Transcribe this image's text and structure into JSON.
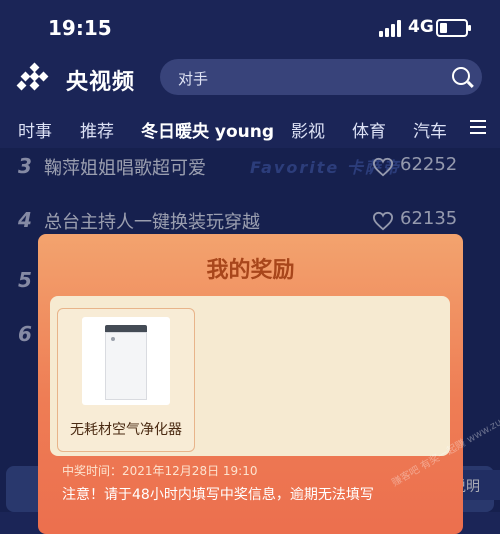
{
  "status_bar": {
    "time": "19:15",
    "network": "4G",
    "battery_level": 0.3
  },
  "header": {
    "app_name": "央视频",
    "search_placeholder": "对手"
  },
  "tabs": [
    {
      "label": "时事"
    },
    {
      "label": "推荐"
    },
    {
      "label": "冬日暖央 young",
      "active": true
    },
    {
      "label": "影视"
    },
    {
      "label": "体育"
    },
    {
      "label": "汽车"
    }
  ],
  "background": {
    "banner_text": "Favorite 卡萨帝",
    "ranking": [
      {
        "rank": "3",
        "title": "鞠萍姐姐唱歌超可爱",
        "likes": "62252"
      },
      {
        "rank": "4",
        "title": "总台主持人一键换装玩穿越",
        "likes": "62135"
      },
      {
        "rank": "5",
        "title": "",
        "likes": ""
      },
      {
        "rank": "6",
        "title": "",
        "likes": ""
      }
    ],
    "explain_label": "说明"
  },
  "reward_modal": {
    "title": "我的奖励",
    "prize_name": "无耗材空气净化器",
    "win_time": "中奖时间：2021年12月28日 19:10",
    "notice": "注意！请于48小时内填写中奖信息，逾期无法填写"
  },
  "watermark": "赚客吧 有奖一起赚 www.zuanke8.com",
  "colors": {
    "accent": "#ee7d55",
    "title": "#a8461b",
    "background": "#1b2557"
  }
}
